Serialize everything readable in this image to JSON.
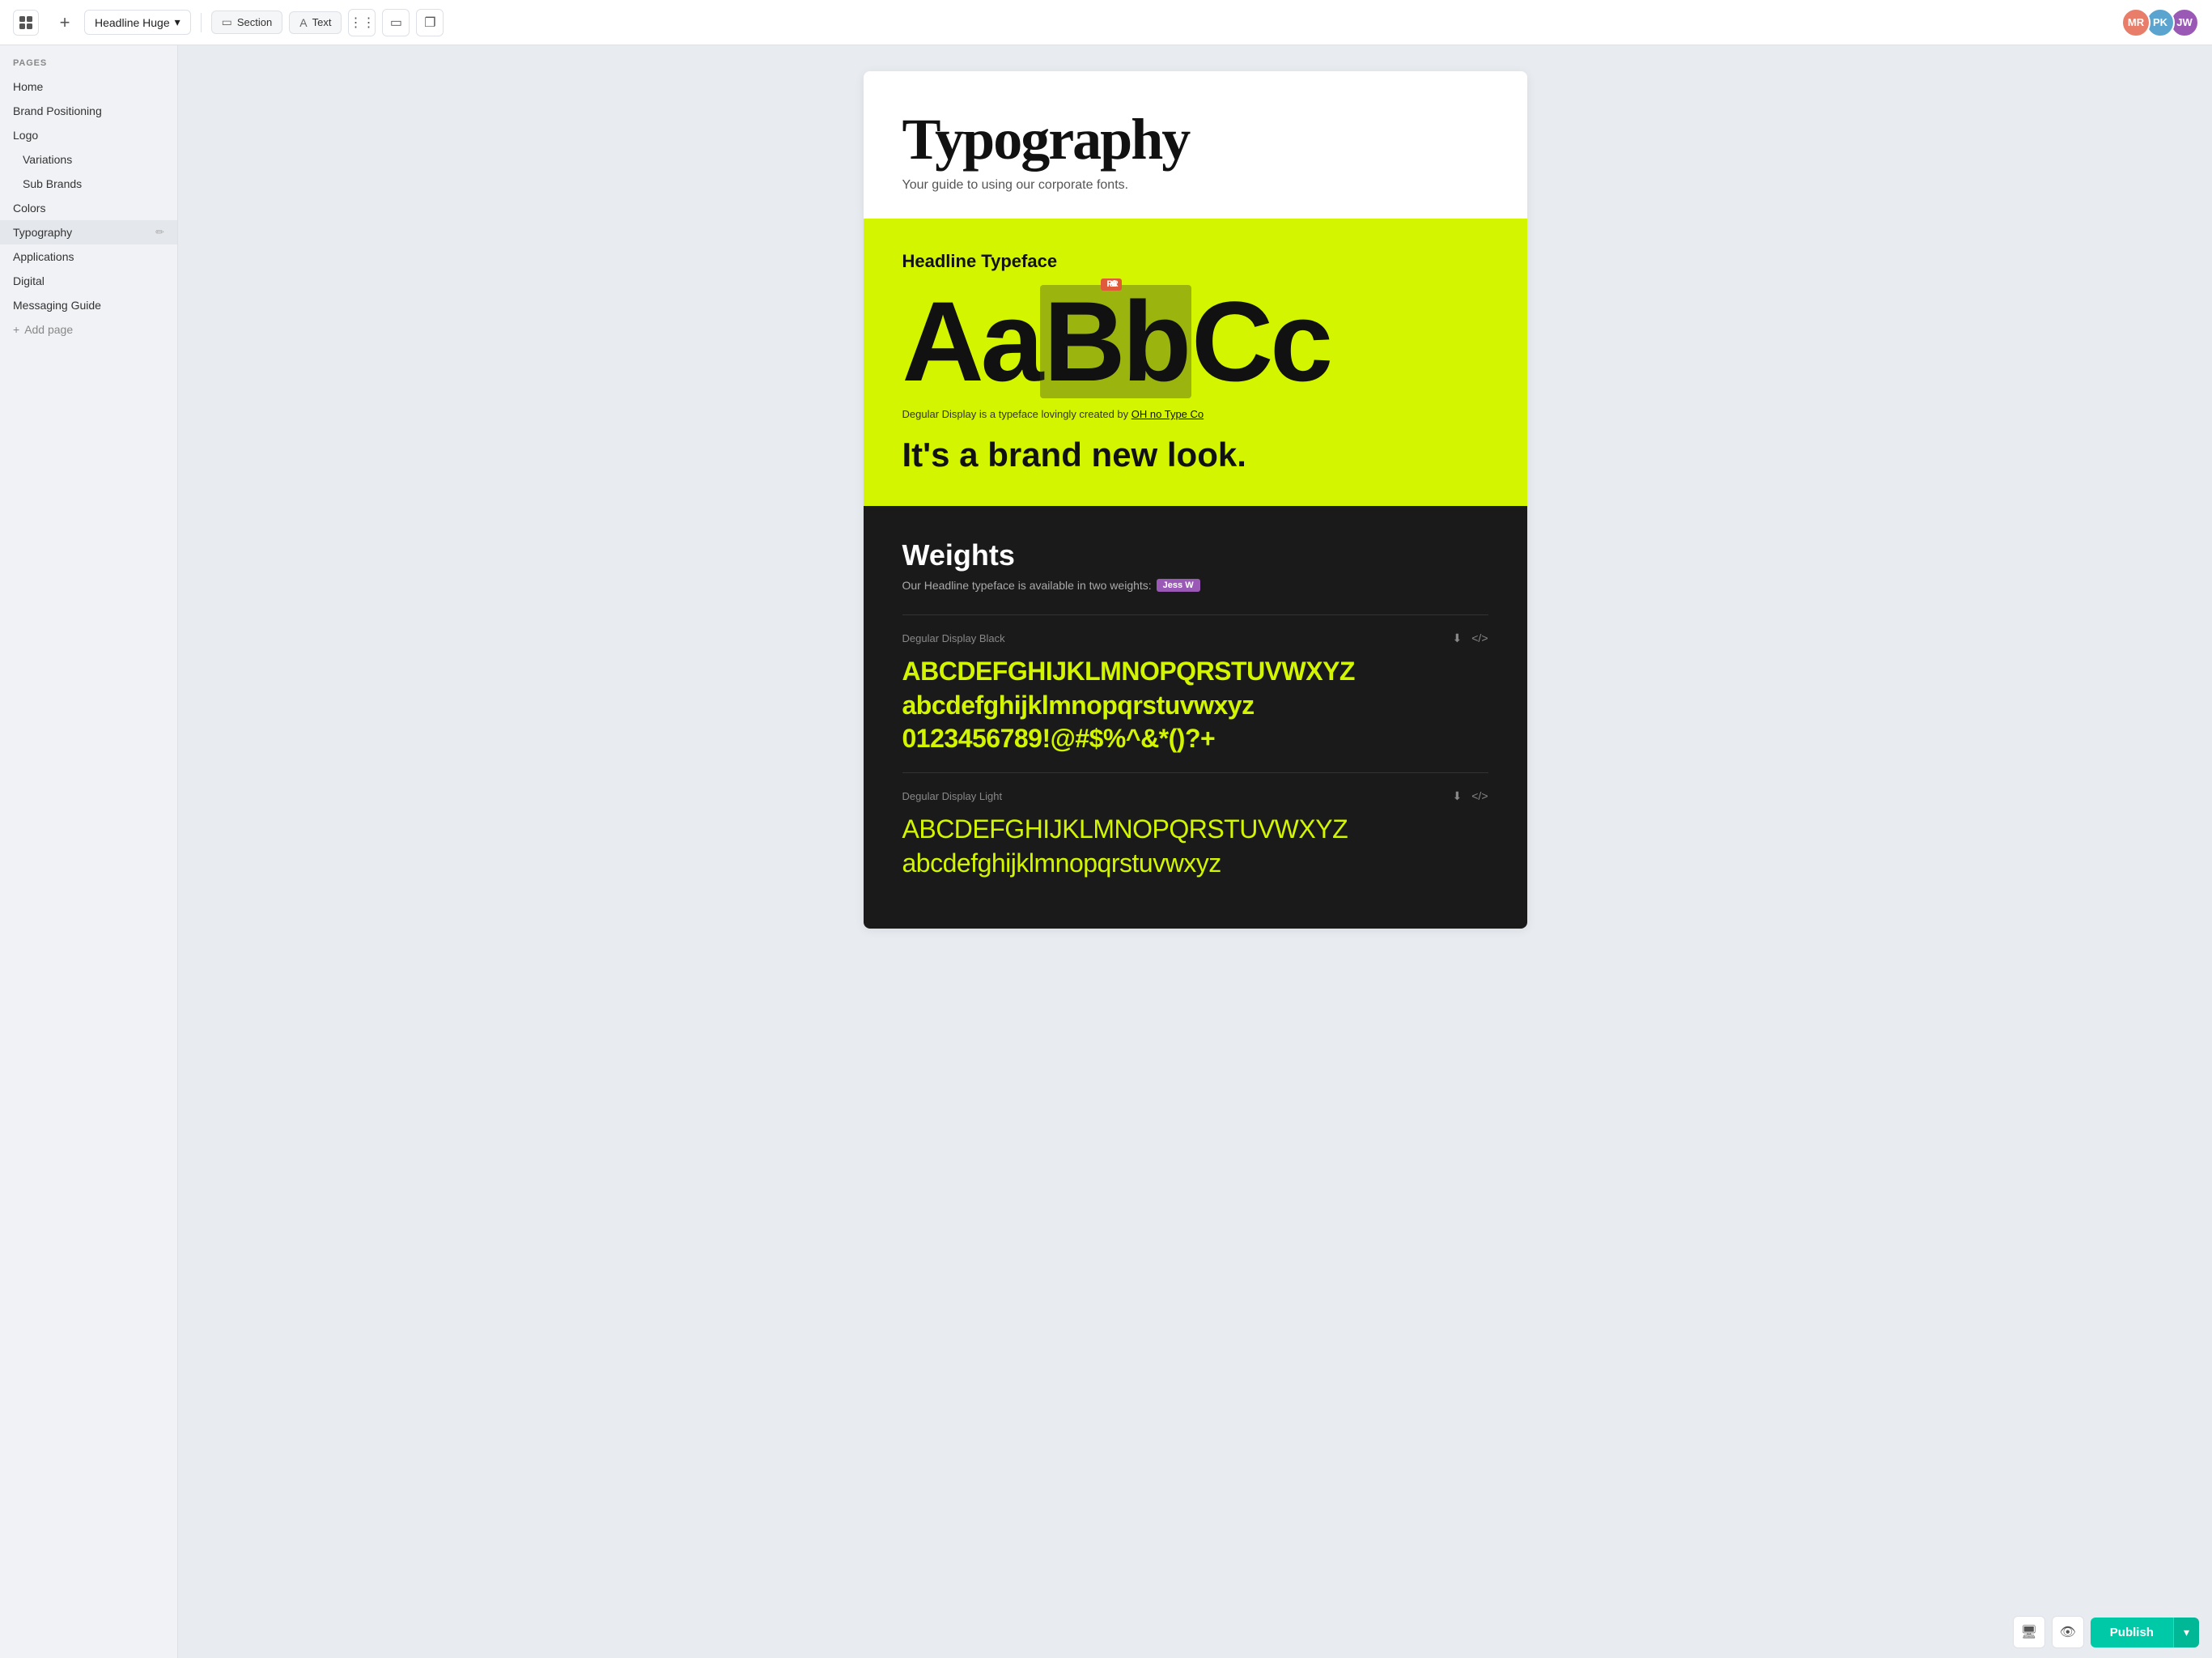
{
  "toolbar": {
    "add_label": "+",
    "dropdown_label": "Headline Huge",
    "dropdown_chevron": "▾",
    "section_label": "Section",
    "text_label": "Text",
    "icon1": "⋮⋮",
    "icon2": "▭",
    "icon3": "❐"
  },
  "sidebar": {
    "section_label": "PAGES",
    "items": [
      {
        "id": "home",
        "label": "Home",
        "indent": false,
        "active": false
      },
      {
        "id": "brand-positioning",
        "label": "Brand Positioning",
        "indent": false,
        "active": false
      },
      {
        "id": "logo",
        "label": "Logo",
        "indent": false,
        "active": false
      },
      {
        "id": "variations",
        "label": "Variations",
        "indent": true,
        "active": false
      },
      {
        "id": "sub-brands",
        "label": "Sub Brands",
        "indent": true,
        "active": false
      },
      {
        "id": "colors",
        "label": "Colors",
        "indent": false,
        "active": false
      },
      {
        "id": "typography",
        "label": "Typography",
        "indent": false,
        "active": true
      },
      {
        "id": "applications",
        "label": "Applications",
        "indent": false,
        "active": false
      },
      {
        "id": "digital",
        "label": "Digital",
        "indent": false,
        "active": false
      },
      {
        "id": "messaging-guide",
        "label": "Messaging Guide",
        "indent": false,
        "active": false
      }
    ],
    "add_label": "+ Add page"
  },
  "page": {
    "hero": {
      "title": "Typography",
      "subtitle": "Your guide to using our corporate fonts."
    },
    "yellow_section": {
      "typeface_label": "Headline Typeface",
      "big_letters": "AaBbCc",
      "letters_a": "Aa",
      "letters_b": "Bb",
      "letters_c": "Cc",
      "cursor_user": "Paul R",
      "brand_tagline": "It's a brand new look.",
      "font_desc_prefix": "Degular Display is a typeface lovingly created by ",
      "font_desc_link": "OH no Type Co"
    },
    "dark_section": {
      "weights_title": "Weights",
      "weights_desc": "Our Headline typeface is available in two weights:",
      "cursor_user": "Jess W",
      "font_blocks": [
        {
          "name": "Degular Display Black",
          "weight": "black",
          "chars_upper": "ABCDEFGHIJKLMNOPQRSTUVWXYZ",
          "chars_lower": "abcdefghijklmnopqrstuvwxyz",
          "chars_num": "0123456789!@#$%^&*()?+"
        },
        {
          "name": "Degular Display Light",
          "weight": "light",
          "chars_upper": "ABCDEFGHIJKLMNOPQRSTUVWXYZ",
          "chars_lower": "abcdefghijklmnopqrstuvwxyz"
        }
      ]
    }
  },
  "bottom_bar": {
    "preview_icon": "⬚",
    "eye_icon": "👁",
    "publish_label": "Publish",
    "publish_caret": "▾"
  },
  "avatars": [
    {
      "initials": "MR",
      "color": "#e87d6a"
    },
    {
      "initials": "PK",
      "color": "#5ba4cf"
    },
    {
      "initials": "JW",
      "color": "#9b59b6"
    }
  ]
}
